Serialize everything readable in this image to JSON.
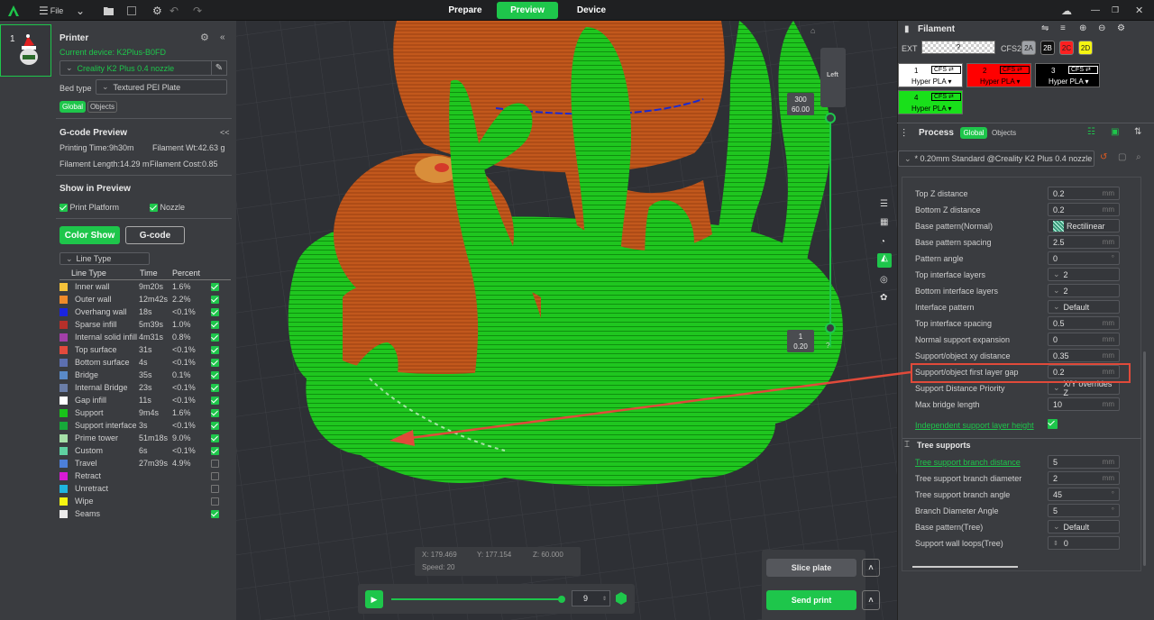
{
  "topbar": {
    "file": "File",
    "tabs": [
      "Prepare",
      "Preview",
      "Device"
    ],
    "active": "Preview"
  },
  "printer": {
    "title": "Printer",
    "plate_num": "1",
    "device": "Current device: K2Plus-B0FD",
    "nozzle": "Creality K2 Plus 0.4 nozzle",
    "bed_label": "Bed type",
    "bed": "Textured PEI Plate",
    "tab_global": "Global",
    "tab_objects": "Objects"
  },
  "gcode": {
    "title": "G-code Preview",
    "collapse": "<<",
    "print_time": "Printing Time:9h30m",
    "fil_wt": "Filament Wt:42.63 g",
    "fil_len": "Filament Length:14.29 m",
    "fil_cost": "Filament Cost:0.85"
  },
  "show": {
    "title": "Show in Preview",
    "platform": "Print Platform",
    "nozzle": "Nozzle",
    "color_show": "Color Show",
    "gcode_btn": "G-code",
    "line_type": "Line Type",
    "col_type": "Line Type",
    "col_time": "Time",
    "col_pct": "Percent"
  },
  "legend": [
    {
      "name": "Inner wall",
      "time": "9m20s",
      "pct": "1.6%",
      "color": "#f5c23a",
      "on": true
    },
    {
      "name": "Outer wall",
      "time": "12m42s",
      "pct": "2.2%",
      "color": "#ef8a2a",
      "on": true
    },
    {
      "name": "Overhang wall",
      "time": "18s",
      "pct": "<0.1%",
      "color": "#1a24e0",
      "on": true
    },
    {
      "name": "Sparse infill",
      "time": "5m39s",
      "pct": "1.0%",
      "color": "#b5302a",
      "on": true
    },
    {
      "name": "Internal solid infill",
      "time": "4m31s",
      "pct": "0.8%",
      "color": "#a23fa8",
      "on": true
    },
    {
      "name": "Top surface",
      "time": "31s",
      "pct": "<0.1%",
      "color": "#e34a3c",
      "on": true
    },
    {
      "name": "Bottom surface",
      "time": "4s",
      "pct": "<0.1%",
      "color": "#5c6fb0",
      "on": true
    },
    {
      "name": "Bridge",
      "time": "35s",
      "pct": "0.1%",
      "color": "#5a8ac8",
      "on": true
    },
    {
      "name": "Internal Bridge",
      "time": "23s",
      "pct": "<0.1%",
      "color": "#6b7ea8",
      "on": true
    },
    {
      "name": "Gap infill",
      "time": "11s",
      "pct": "<0.1%",
      "color": "#ffffff",
      "on": true
    },
    {
      "name": "Support",
      "time": "9m4s",
      "pct": "1.6%",
      "color": "#19c21a",
      "on": true
    },
    {
      "name": "Support interface",
      "time": "3s",
      "pct": "<0.1%",
      "color": "#17a93a",
      "on": true
    },
    {
      "name": "Prime tower",
      "time": "51m18s",
      "pct": "9.0%",
      "color": "#a6e0a8",
      "on": true
    },
    {
      "name": "Custom",
      "time": "6s",
      "pct": "<0.1%",
      "color": "#5fd1a1",
      "on": true
    },
    {
      "name": "Travel",
      "time": "27m39s",
      "pct": "4.9%",
      "color": "#4c7fd9",
      "on": false
    },
    {
      "name": "Retract",
      "time": "",
      "pct": "",
      "color": "#d91ad6",
      "on": false
    },
    {
      "name": "Unretract",
      "time": "",
      "pct": "",
      "color": "#1fb5e0",
      "on": false
    },
    {
      "name": "Wipe",
      "time": "",
      "pct": "",
      "color": "#f5f511",
      "on": false
    },
    {
      "name": "Seams",
      "time": "",
      "pct": "",
      "color": "#ececec",
      "on": true
    }
  ],
  "viewport": {
    "layer_top": "300",
    "height_top": "60.00",
    "layer_bot": "1",
    "height_bot": "0.20",
    "view_label": "Left",
    "help": "?"
  },
  "coords": {
    "x": "X: 179.469",
    "y": "Y: 177.154",
    "z": "Z: 60.000",
    "speed": "Speed: 20"
  },
  "playback": {
    "value": "9"
  },
  "slice": {
    "slice_plate": "Slice plate",
    "send_print": "Send print"
  },
  "filament": {
    "title": "Filament",
    "ext": "EXT",
    "ext_q": "?",
    "cfs2": "CFS2",
    "slots2": [
      {
        "id": "2A",
        "color": "#a0a3a8",
        "fg": "#222"
      },
      {
        "id": "2B",
        "color": "#111111",
        "fg": "#fff"
      },
      {
        "id": "2C",
        "color": "#ff2020",
        "fg": "#222"
      },
      {
        "id": "2D",
        "color": "#f5f511",
        "fg": "#222"
      }
    ],
    "slots": [
      {
        "num": "1",
        "cfs": "CFS",
        "type": "Hyper PLA",
        "bg": "#ffffff",
        "fg": "#000"
      },
      {
        "num": "2",
        "cfs": "CFS",
        "type": "Hyper PLA",
        "bg": "#ff0000",
        "fg": "#000"
      },
      {
        "num": "3",
        "cfs": "CFS",
        "type": "Hyper PLA",
        "bg": "#000000",
        "fg": "#fff"
      },
      {
        "num": "4",
        "cfs": "CFS",
        "type": "Hyper PLA",
        "bg": "#19e01a",
        "fg": "#000"
      }
    ]
  },
  "process": {
    "title": "Process",
    "tab_global": "Global",
    "tab_objects": "Objects",
    "profile": "* 0.20mm Standard @Creality K2 Plus 0.4 nozzle"
  },
  "params": [
    {
      "label": "Top Z distance",
      "value": "0.2",
      "unit": "mm"
    },
    {
      "label": "Bottom Z distance",
      "value": "0.2",
      "unit": "mm"
    },
    {
      "label": "Base pattern(Normal)",
      "value": "Rectilinear",
      "unit": ""
    },
    {
      "label": "Base pattern spacing",
      "value": "2.5",
      "unit": "mm"
    },
    {
      "label": "Pattern angle",
      "value": "0",
      "unit": "°"
    },
    {
      "label": "Top interface layers",
      "value": "2",
      "unit": ""
    },
    {
      "label": "Bottom interface layers",
      "value": "2",
      "unit": ""
    },
    {
      "label": "Interface pattern",
      "value": "Default",
      "unit": ""
    },
    {
      "label": "Top interface spacing",
      "value": "0.5",
      "unit": "mm"
    },
    {
      "label": "Normal support expansion",
      "value": "0",
      "unit": "mm"
    },
    {
      "label": "Support/object xy distance",
      "value": "0.35",
      "unit": "mm"
    },
    {
      "label": "Support/object first layer gap",
      "value": "0.2",
      "unit": "mm"
    },
    {
      "label": "Support Distance Priority",
      "value": "X/Y overrides Z",
      "unit": ""
    },
    {
      "label": "Max bridge length",
      "value": "10",
      "unit": "mm"
    }
  ],
  "indep": {
    "label": "Independent support layer height"
  },
  "tree": {
    "title": "Tree supports",
    "params": [
      {
        "label": "Tree support branch distance",
        "value": "5",
        "unit": "mm"
      },
      {
        "label": "Tree support branch diameter",
        "value": "2",
        "unit": "mm"
      },
      {
        "label": "Tree support branch angle",
        "value": "45",
        "unit": "°"
      },
      {
        "label": "Branch Diameter Angle",
        "value": "5",
        "unit": "°"
      },
      {
        "label": "Base pattern(Tree)",
        "value": "Default",
        "unit": ""
      },
      {
        "label": "Support wall loops(Tree)",
        "value": "0",
        "unit": ""
      }
    ]
  }
}
